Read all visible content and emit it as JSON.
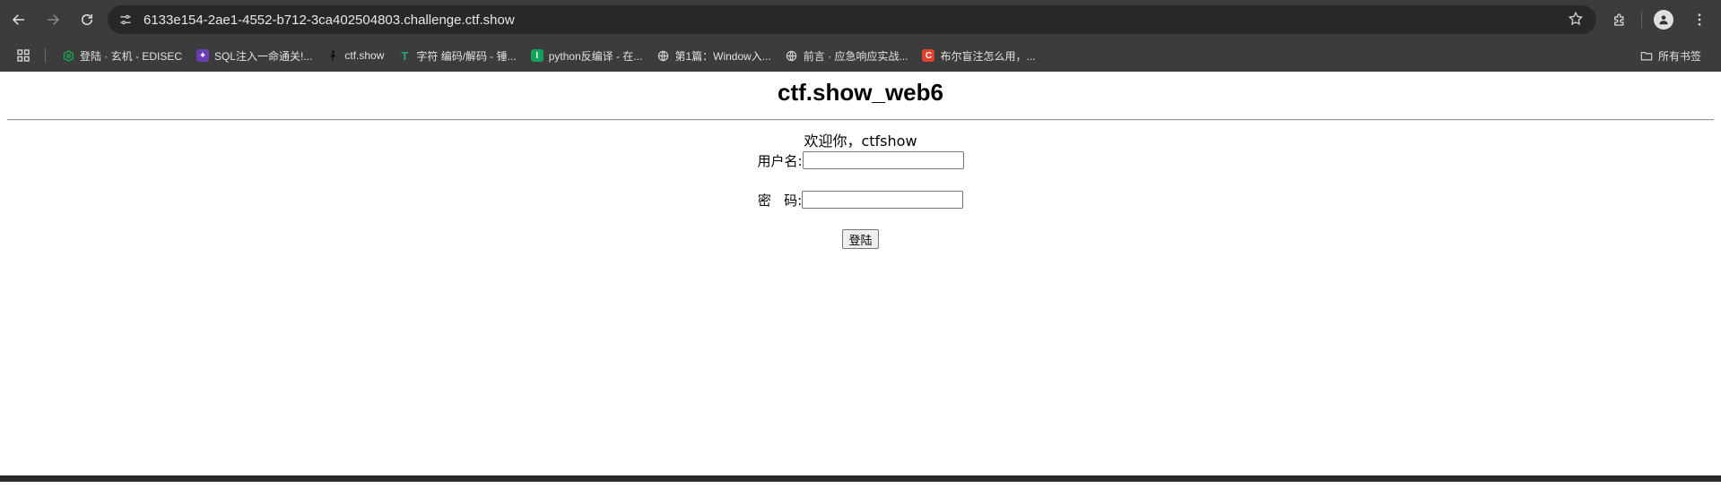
{
  "browser": {
    "url": "6133e154-2ae1-4552-b712-3ca402504803.challenge.ctf.show",
    "bookmarks": [
      {
        "label": "登陆 · 玄机 - EDISEC",
        "icon": "hexagon-icon",
        "color": "#1aa34a"
      },
      {
        "label": "SQL注入一命通关!...",
        "icon": "purple-square-icon",
        "color": "#6a3fb5"
      },
      {
        "label": "ctf.show",
        "icon": "figure-icon",
        "color": "#222222"
      },
      {
        "label": "字符 编码/解码 - 锤...",
        "icon": "t-icon",
        "color": "#2aa876"
      },
      {
        "label": "python反编译 - 在...",
        "icon": "green-square-icon",
        "color": "#12a35b"
      },
      {
        "label": "第1篇：Window入...",
        "icon": "globe-icon",
        "color": "#cfcfcf"
      },
      {
        "label": "前言 · 应急响应实战...",
        "icon": "globe-icon",
        "color": "#cfcfcf"
      },
      {
        "label": "布尔盲注怎么用，...",
        "icon": "c-icon",
        "color": "#e0422e"
      }
    ],
    "bookmarks_folder": "所有书签"
  },
  "page": {
    "title": "ctf.show_web6",
    "welcome": "欢迎你，ctfshow",
    "username_label": "用户名:",
    "password_label": "密   码:",
    "submit_label": "登陆"
  }
}
